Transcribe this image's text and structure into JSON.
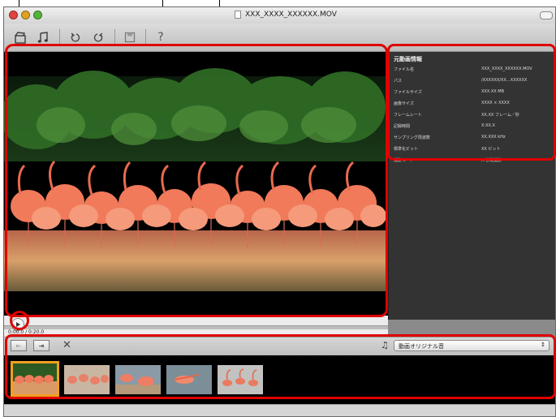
{
  "window": {
    "title": "XXX_XXXX_XXXXXX.MOV"
  },
  "toolbar": {
    "help_label": "?"
  },
  "info_panel": {
    "heading": "元動画情報",
    "rows": [
      {
        "label": "ファイル名",
        "value": "XXX_XXXX_XXXXXX.MOV"
      },
      {
        "label": "パス",
        "value": "/XXXXXX/XX…XXXXXX"
      },
      {
        "label": "ファイルサイズ",
        "value": "XXX.XX MB"
      },
      {
        "label": "画像サイズ",
        "value": "XXXX × XXXX"
      },
      {
        "label": "フレームレート",
        "value": "XX.XX フレーム／秒"
      },
      {
        "label": "記録時間",
        "value": "X:XX.X"
      },
      {
        "label": "サンプリング周波数",
        "value": "XX.XXX kHz"
      },
      {
        "label": "標準化ビット",
        "value": "XX ビット"
      },
      {
        "label": "撮影モード",
        "value": "X 秒間撮影"
      }
    ]
  },
  "timeline": {
    "timecode": "0:00.0 / 0:20.0",
    "progress": 0
  },
  "editbar": {
    "audio_select_value": "動画オリジナル音"
  },
  "icons": {
    "movie": "clapper-icon",
    "music": "music-note-icon",
    "rotate_left": "rotate-left-icon",
    "rotate_right": "rotate-right-icon",
    "save": "save-icon",
    "help": "help-icon",
    "delete": "close-icon"
  },
  "colors": {
    "highlight": "#e00000",
    "selected_thumb": "#f0a020"
  }
}
